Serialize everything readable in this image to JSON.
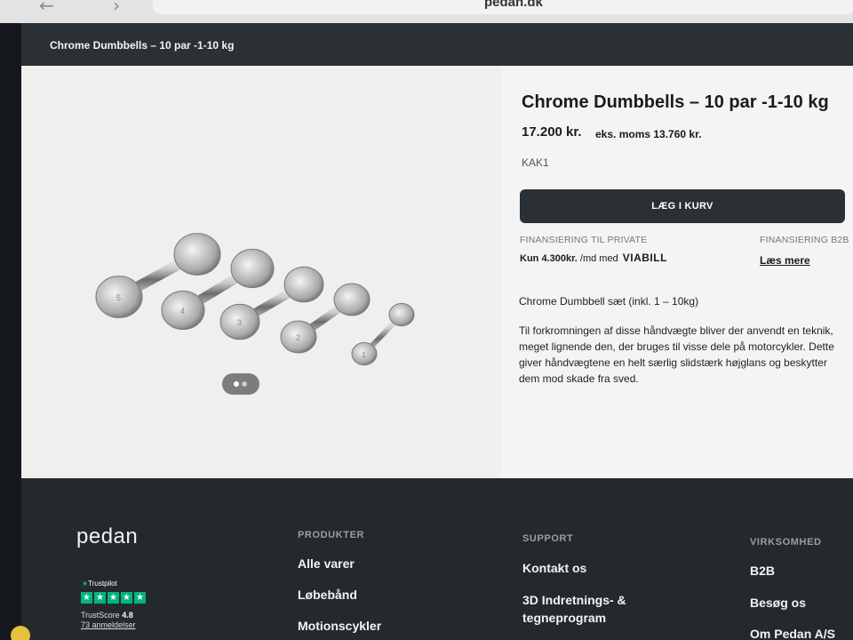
{
  "browser": {
    "nav_icons": "← › ↻",
    "url_text": "pedan.dk"
  },
  "breadcrumb": "Chrome Dumbbells – 10 par -1-10 kg",
  "product": {
    "title": "Chrome Dumbbells – 10 par -1-10 kg",
    "price": "17.200 kr.",
    "price_ex_vat": "eks. moms 13.760 kr.",
    "sku": "KAK1",
    "add_to_cart": "LÆG I KURV",
    "financing": {
      "private_label": "FINANSIERING TIL PRIVATE",
      "monthly_amount": "Kun 4.300kr.",
      "monthly_suffix": "/md med",
      "provider": "VIABILL",
      "b2b_label": "FINANSIERING B2B",
      "b2b_link": "Læs mere"
    },
    "description_intro": "Chrome Dumbbell sæt (inkl. 1 – 10kg)",
    "description": "Til forkromningen af disse håndvægte bliver der anvendt en teknik, meget lignende den, der bruges til visse dele på motorcykler. Dette giver håndvægtene en helt særlig slidstærk højglans og beskytter dem mod skade fra sved.",
    "gallery": {
      "image_count": 2,
      "active_index": 0,
      "weight_labels": [
        "5",
        "4",
        "3",
        "2",
        "1"
      ]
    }
  },
  "footer": {
    "logo": "pedan",
    "trustpilot": {
      "brand": "Trustpilot",
      "score_label": "TrustScore",
      "score": "4.8",
      "reviews": "73 anmeldelser",
      "stars": 5
    },
    "columns": [
      {
        "heading": "PRODUKTER",
        "links": [
          "Alle varer",
          "Løbebånd",
          "Motionscykler"
        ]
      },
      {
        "heading": "SUPPORT",
        "links": [
          "Kontakt os",
          "3D Indretnings- & tegneprogram"
        ]
      },
      {
        "heading": "VIRKSOMHED",
        "links": [
          "B2B",
          "Besøg os",
          "Om Pedan A/S"
        ]
      }
    ]
  }
}
